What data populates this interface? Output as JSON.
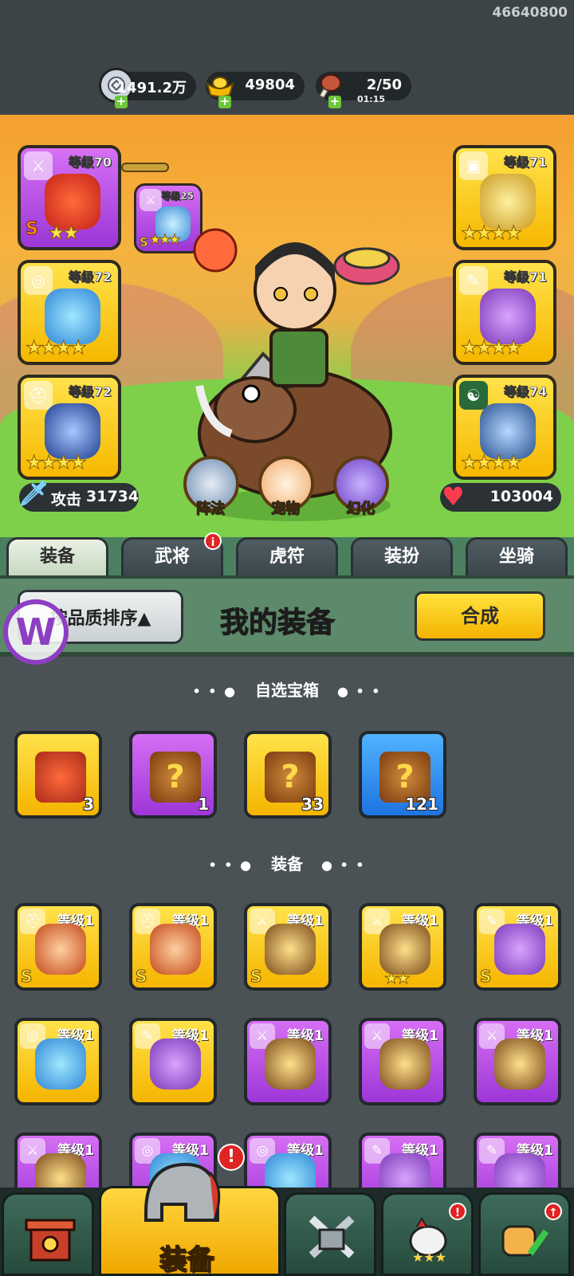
{
  "player": {
    "uid": "46640800"
  },
  "resources": {
    "silver": {
      "icon": "silver-coin-icon",
      "value": "1491.2万"
    },
    "gold": {
      "icon": "gold-ingot-icon",
      "value": "49804"
    },
    "stamina": {
      "icon": "meat-icon",
      "value": "2/50",
      "timer": "01:15"
    }
  },
  "hero_equipment": {
    "left": [
      {
        "level": "等级70",
        "rarity": "purple",
        "type": "sword",
        "stars": "★★",
        "rank": "S"
      },
      {
        "level": "等级72",
        "rarity": "gold",
        "type": "medal",
        "stars": "★★★★"
      },
      {
        "level": "等级72",
        "rarity": "gold",
        "type": "helmet",
        "stars": "★★★★"
      }
    ],
    "right": [
      {
        "level": "等级71",
        "rarity": "gold",
        "type": "armor",
        "stars": "★★★★"
      },
      {
        "level": "等级71",
        "rarity": "gold",
        "type": "scroll",
        "stars": "★★★★"
      },
      {
        "level": "等级74",
        "rarity": "gold",
        "type": "yinyang",
        "stars": "★★★★"
      }
    ],
    "linked": {
      "level": "等级25",
      "rarity": "purple",
      "stars": "★★★",
      "rank": "S"
    }
  },
  "stats": {
    "attack_label": "攻击",
    "attack_value": "31734",
    "hp_value": "103004"
  },
  "circle_buttons": [
    {
      "label": "阵法",
      "icon": "formation-icon"
    },
    {
      "label": "宠物",
      "icon": "cat-pet-icon"
    },
    {
      "label": "幻化",
      "icon": "transform-icon"
    }
  ],
  "tabs": [
    {
      "label": "装备",
      "active": true
    },
    {
      "label": "武将",
      "badge": "i"
    },
    {
      "label": "虎符"
    },
    {
      "label": "装扮"
    },
    {
      "label": "坐骑"
    }
  ],
  "panel": {
    "sort_label": "按品质排序▲",
    "title": "我的装备",
    "combine_label": "合成"
  },
  "sections": {
    "chests_title": "自选宝箱",
    "equipment_title": "装备",
    "dots_left": "• • ●",
    "dots_right": "● • •"
  },
  "chests": [
    {
      "rarity": "gold",
      "count": "3",
      "icon": "multi-chest-icon"
    },
    {
      "rarity": "purple",
      "count": "1",
      "icon": "mystery-chest-icon"
    },
    {
      "rarity": "gold",
      "count": "33",
      "icon": "mystery-chest-icon"
    },
    {
      "rarity": "blue",
      "count": "121",
      "icon": "mystery-chest-icon"
    }
  ],
  "equipment": [
    {
      "level": "等级1",
      "rarity": "gold",
      "type": "helmet",
      "rank": "S"
    },
    {
      "level": "等级1",
      "rarity": "gold",
      "type": "helmet",
      "rank": "S"
    },
    {
      "level": "等级1",
      "rarity": "gold",
      "type": "sword",
      "rank": "S"
    },
    {
      "level": "等级1",
      "rarity": "gold",
      "type": "sword",
      "stars": "★★"
    },
    {
      "level": "等级1",
      "rarity": "gold",
      "type": "scroll",
      "rank": "S"
    },
    {
      "level": "等级1",
      "rarity": "gold",
      "type": "medal"
    },
    {
      "level": "等级1",
      "rarity": "gold",
      "type": "scroll"
    },
    {
      "level": "等级1",
      "rarity": "purple",
      "type": "sword"
    },
    {
      "level": "等级1",
      "rarity": "purple",
      "type": "sword"
    },
    {
      "level": "等级1",
      "rarity": "purple",
      "type": "sword"
    },
    {
      "level": "等级1",
      "rarity": "purple",
      "type": "sword"
    },
    {
      "level": "等级1",
      "rarity": "purple",
      "type": "medal"
    },
    {
      "level": "等级1",
      "rarity": "purple",
      "type": "medal"
    },
    {
      "level": "等级1",
      "rarity": "purple",
      "type": "scroll"
    },
    {
      "level": "等级1",
      "rarity": "purple",
      "type": "scroll"
    }
  ],
  "bottom_nav": [
    {
      "icon": "gate-icon"
    },
    {
      "label": "装备",
      "icon": "helmet-icon",
      "active": true,
      "badge": "!"
    },
    {
      "icon": "crossed-swords-icon"
    },
    {
      "icon": "rooster-icon",
      "badge": "!"
    },
    {
      "icon": "fist-upgrade-icon",
      "badge": "↑"
    }
  ],
  "colors": {
    "gold": "#f5b500",
    "purple": "#9e36d8",
    "blue": "#1e74e0",
    "panel_green": "#5d8a6a",
    "bg": "#4b5256"
  }
}
